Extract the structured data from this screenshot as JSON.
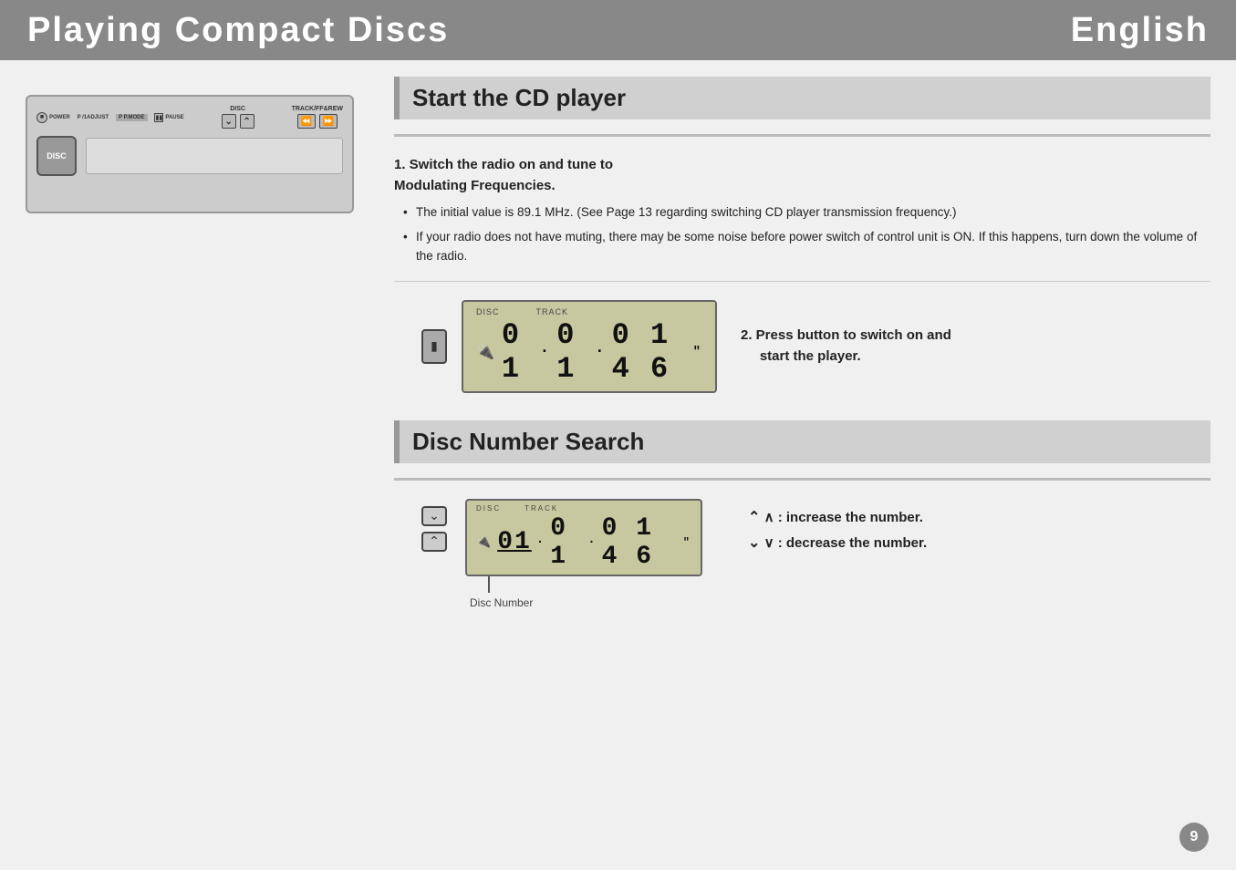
{
  "header": {
    "title": "Playing Compact Discs",
    "language": "English"
  },
  "section1": {
    "title": "Start the CD player"
  },
  "step1": {
    "heading": "1. Switch the radio on and tune to Modulating Frequencies.",
    "bullets": [
      "The initial value is 89.1 MHz. (See Page 13 regarding switching CD player transmission frequency.)",
      "If your radio does not have muting, there may be some noise before power switch of control unit is ON. If this happens, turn down the volume of the radio."
    ]
  },
  "step2": {
    "heading": "2. Press button to switch on and start the player."
  },
  "section2": {
    "title": "Disc Number Search"
  },
  "disc_search": {
    "increase_label": "∧ : increase the number.",
    "decrease_label": "∨ : decrease the number.",
    "disc_number_label": "Disc Number"
  },
  "lcd1": {
    "disc_label": "DISC",
    "track_label": "TRACK",
    "digits": "01  01  0 146\""
  },
  "lcd2": {
    "disc_label": "DISC",
    "track_label": "TRACK",
    "digits": "01  01  0 146\""
  },
  "page_number": "9"
}
